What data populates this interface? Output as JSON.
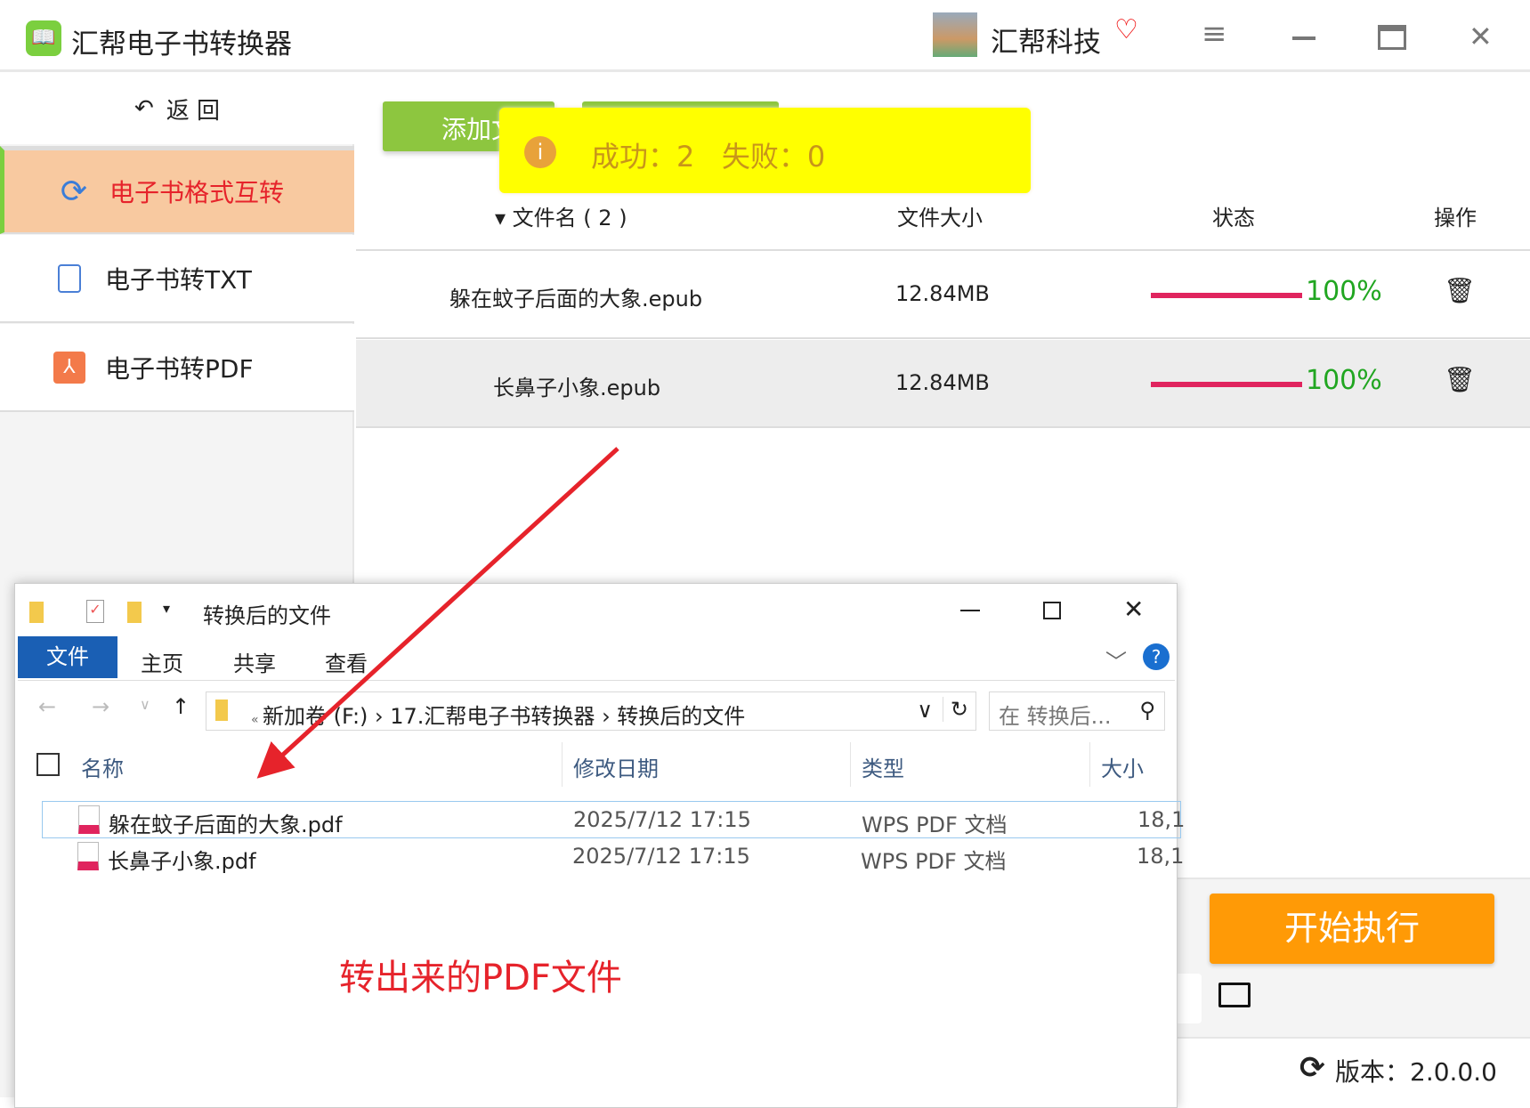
{
  "app": {
    "title": "汇帮电子书转换器",
    "user": "汇帮科技",
    "accent": "#7bcf3f"
  },
  "sidebar": {
    "back": "返 回",
    "items": [
      {
        "label": "电子书格式互转",
        "active": true
      },
      {
        "label": "电子书转TXT"
      },
      {
        "label": "电子书转PDF"
      }
    ]
  },
  "toolbar": {
    "add_label": "添加文件"
  },
  "toast": {
    "text": "成功：2   失败：0",
    "color": "#ffff00"
  },
  "table": {
    "headers": [
      "▾ 文件名 ( 2 )",
      "文件大小",
      "状态",
      "操作"
    ],
    "rows": [
      {
        "name": "躲在蚊子后面的大象.epub",
        "size": "12.84MB",
        "progress": 100,
        "progress_label": "100%"
      },
      {
        "name": "长鼻子小象.epub",
        "size": "12.84MB",
        "progress": 100,
        "progress_label": "100%"
      }
    ]
  },
  "start_label": "开始执行",
  "version": "版本：2.0.0.0",
  "explorer": {
    "title": "转换后的文件",
    "tabs": [
      "文件",
      "主页",
      "共享",
      "查看"
    ],
    "path": [
      "新加卷 (F:)",
      "17.汇帮电子书转换器",
      "转换后的文件"
    ],
    "search_placeholder": "在 转换后...",
    "headers": [
      "名称",
      "修改日期",
      "类型",
      "大小"
    ],
    "files": [
      {
        "name": "躲在蚊子后面的大象.pdf",
        "date": "2025/7/12 17:15",
        "type": "WPS PDF 文档",
        "size": "18,1"
      },
      {
        "name": "长鼻子小象.pdf",
        "date": "2025/7/12 17:15",
        "type": "WPS PDF 文档",
        "size": "18,1"
      }
    ]
  },
  "annotation": "转出来的PDF文件"
}
